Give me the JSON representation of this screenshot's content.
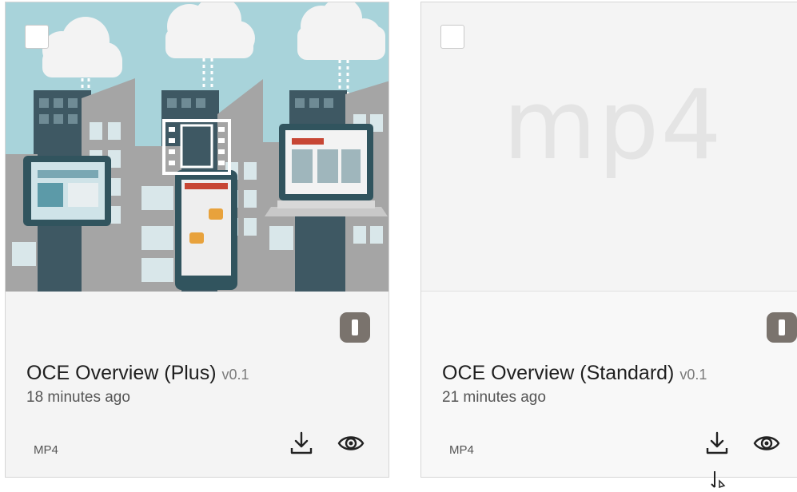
{
  "cards": [
    {
      "title": "OCE Overview (Plus)",
      "version": "v0.1",
      "modified": "18 minutes ago",
      "file_type": "MP4",
      "thumbnail": "city-devices-illustration",
      "has_video_icon": true,
      "lock_badge_color": "#7a736d"
    },
    {
      "title": "OCE Overview (Standard)",
      "version": "v0.1",
      "modified": "21 minutes ago",
      "file_type": "MP4",
      "thumbnail_placeholder": "mp4",
      "lock_badge_color": "#7a736d"
    }
  ],
  "icons": {
    "select": "checkbox-icon",
    "video": "film-strip-icon",
    "lock": "lock-badge-icon",
    "download": "download-icon",
    "preview": "eye-icon"
  }
}
